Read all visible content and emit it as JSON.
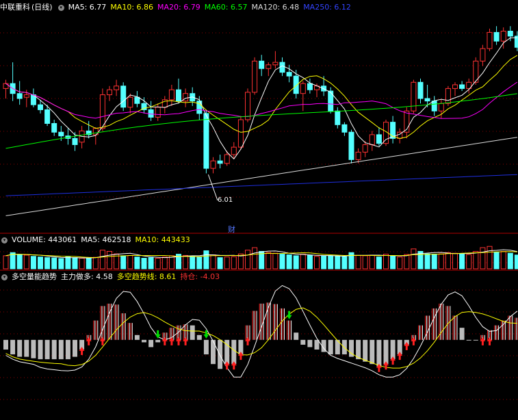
{
  "stock": {
    "name": "中联重科",
    "period": "(日线)"
  },
  "colors": {
    "up": "#ff3232",
    "down": "#54ffff",
    "ma5": "#ffffff",
    "ma10": "#ffff00",
    "ma20": "#ff00ff",
    "ma60": "#00ff00",
    "ma120": "#ffffff",
    "ma250": "#0000ff",
    "grid": "#8b0000",
    "gray": "#bbbbbb",
    "green_arrow": "#00dd00"
  },
  "price_header": {
    "ma5": "MA5: 6.77",
    "ma10": "MA10: 6.86",
    "ma20": "MA20: 6.79",
    "ma60": "MA60: 6.57",
    "ma120": "MA120: 6.48",
    "ma250": "MA250: 6.12"
  },
  "volume_header": {
    "volume": "VOLUME: 443061",
    "ma5": "MA5: 462518",
    "ma10": "MA10: 443433"
  },
  "indicator_header": {
    "name": "多空量能趋势",
    "main": "主力做多: 4.58",
    "trend": "多空趋势线: 8.61",
    "hold": "持仓: -4.03"
  },
  "annotations": {
    "low_label": "6.01",
    "fin_marker": "财"
  },
  "chart_data": [
    {
      "type": "candlestick",
      "title": "中联重科 (日线)",
      "y_range": [
        5.6,
        7.3
      ],
      "candles": [
        [
          6.7,
          6.77,
          6.62,
          6.74
        ],
        [
          6.74,
          6.91,
          6.6,
          6.66
        ],
        [
          6.66,
          6.76,
          6.57,
          6.62
        ],
        [
          6.63,
          6.69,
          6.55,
          6.65
        ],
        [
          6.65,
          6.7,
          6.55,
          6.57
        ],
        [
          6.57,
          6.61,
          6.5,
          6.53
        ],
        [
          6.53,
          6.57,
          6.4,
          6.42
        ],
        [
          6.42,
          6.45,
          6.32,
          6.35
        ],
        [
          6.35,
          6.4,
          6.28,
          6.32
        ],
        [
          6.32,
          6.38,
          6.25,
          6.3
        ],
        [
          6.3,
          6.35,
          6.2,
          6.25
        ],
        [
          6.27,
          6.4,
          6.22,
          6.36
        ],
        [
          6.36,
          6.44,
          6.3,
          6.33
        ],
        [
          6.33,
          6.39,
          6.25,
          6.38
        ],
        [
          6.38,
          6.7,
          6.36,
          6.65
        ],
        [
          6.65,
          6.72,
          6.6,
          6.69
        ],
        [
          6.69,
          6.77,
          6.64,
          6.72
        ],
        [
          6.72,
          6.75,
          6.52,
          6.55
        ],
        [
          6.55,
          6.66,
          6.5,
          6.63
        ],
        [
          6.63,
          6.68,
          6.55,
          6.58
        ],
        [
          6.58,
          6.63,
          6.5,
          6.53
        ],
        [
          6.53,
          6.6,
          6.44,
          6.47
        ],
        [
          6.47,
          6.58,
          6.44,
          6.55
        ],
        [
          6.55,
          6.64,
          6.5,
          6.61
        ],
        [
          6.61,
          6.73,
          6.56,
          6.69
        ],
        [
          6.69,
          6.78,
          6.58,
          6.6
        ],
        [
          6.6,
          6.7,
          6.55,
          6.66
        ],
        [
          6.66,
          6.71,
          6.56,
          6.6
        ],
        [
          6.6,
          6.64,
          6.45,
          6.5
        ],
        [
          6.5,
          6.53,
          6.02,
          6.06
        ],
        [
          6.06,
          6.15,
          6.02,
          6.12
        ],
        [
          6.12,
          6.17,
          6.06,
          6.1
        ],
        [
          6.1,
          6.2,
          6.08,
          6.17
        ],
        [
          6.17,
          6.27,
          6.14,
          6.23
        ],
        [
          6.23,
          6.48,
          6.21,
          6.45
        ],
        [
          6.45,
          6.7,
          6.43,
          6.67
        ],
        [
          6.67,
          6.95,
          6.65,
          6.92
        ],
        [
          6.92,
          6.97,
          6.8,
          6.86
        ],
        [
          6.86,
          6.91,
          6.8,
          6.89
        ],
        [
          6.89,
          7.0,
          6.86,
          6.91
        ],
        [
          6.91,
          6.95,
          6.8,
          6.83
        ],
        [
          6.83,
          6.89,
          6.75,
          6.8
        ],
        [
          6.8,
          6.85,
          6.62,
          6.66
        ],
        [
          6.66,
          6.76,
          6.52,
          6.74
        ],
        [
          6.74,
          6.78,
          6.66,
          6.69
        ],
        [
          6.69,
          6.74,
          6.63,
          6.72
        ],
        [
          6.72,
          6.8,
          6.64,
          6.68
        ],
        [
          6.68,
          6.71,
          6.5,
          6.52
        ],
        [
          6.52,
          6.55,
          6.38,
          6.41
        ],
        [
          6.41,
          6.43,
          6.32,
          6.35
        ],
        [
          6.35,
          6.37,
          6.1,
          6.13
        ],
        [
          6.13,
          6.22,
          6.1,
          6.19
        ],
        [
          6.19,
          6.28,
          6.15,
          6.25
        ],
        [
          6.25,
          6.36,
          6.2,
          6.33
        ],
        [
          6.33,
          6.39,
          6.24,
          6.26
        ],
        [
          6.26,
          6.45,
          6.24,
          6.43
        ],
        [
          6.43,
          6.48,
          6.26,
          6.3
        ],
        [
          6.3,
          6.38,
          6.26,
          6.35
        ],
        [
          6.35,
          6.55,
          6.3,
          6.52
        ],
        [
          6.52,
          6.77,
          6.5,
          6.75
        ],
        [
          6.75,
          6.78,
          6.58,
          6.62
        ],
        [
          6.62,
          6.73,
          6.55,
          6.6
        ],
        [
          6.6,
          6.64,
          6.48,
          6.52
        ],
        [
          6.52,
          6.61,
          6.46,
          6.58
        ],
        [
          6.58,
          6.72,
          6.56,
          6.7
        ],
        [
          6.7,
          6.75,
          6.64,
          6.73
        ],
        [
          6.73,
          6.76,
          6.68,
          6.7
        ],
        [
          6.7,
          6.78,
          6.66,
          6.75
        ],
        [
          6.75,
          6.95,
          6.73,
          6.92
        ],
        [
          6.92,
          7.05,
          6.88,
          7.02
        ],
        [
          7.02,
          7.18,
          7.0,
          7.15
        ],
        [
          7.15,
          7.2,
          7.05,
          7.08
        ],
        [
          7.08,
          7.19,
          7.02,
          7.16
        ],
        [
          7.16,
          7.2,
          7.08,
          7.12
        ],
        [
          7.12,
          7.16,
          7.0,
          7.03
        ]
      ],
      "low_marker": {
        "value": 6.01,
        "label": "6.01"
      }
    },
    {
      "type": "bar",
      "title": "VOLUME",
      "y_range": [
        0,
        1000000
      ],
      "series": [
        {
          "name": "VOLUME",
          "values": [
            420000,
            520000,
            460000,
            440000,
            400000,
            380000,
            360000,
            350000,
            330000,
            380000,
            360000,
            340000,
            330000,
            370000,
            600000,
            560000,
            480000,
            420000,
            430000,
            380000,
            340000,
            360000,
            340000,
            380000,
            420000,
            470000,
            430000,
            400000,
            380000,
            580000,
            450000,
            360000,
            380000,
            390000,
            480000,
            600000,
            680000,
            560000,
            520000,
            500000,
            470000,
            450000,
            420000,
            470000,
            430000,
            400000,
            410000,
            420000,
            410000,
            390000,
            520000,
            430000,
            420000,
            440000,
            380000,
            470000,
            410000,
            380000,
            460000,
            640000,
            560000,
            480000,
            470000,
            480000,
            520000,
            500000,
            490000,
            460000,
            560000,
            680000,
            720000,
            540000,
            560000,
            500000,
            443061
          ]
        }
      ]
    },
    {
      "type": "bar",
      "title": "多空量能趋势",
      "y_range": [
        -16,
        12
      ],
      "series": [
        {
          "name": "主力做多",
          "values": [
            -2,
            -3,
            -3.5,
            -3.5,
            -3.8,
            -4,
            -4,
            -4,
            -4,
            -4,
            -3.5,
            -2,
            1,
            4,
            7,
            7.5,
            7.3,
            5.5,
            3.5,
            1,
            -0.5,
            -1.5,
            -0.5,
            1.5,
            2.5,
            3,
            3.2,
            3,
            1,
            -3,
            -5,
            -6,
            -5,
            -5,
            -3,
            3,
            6,
            7.5,
            7.7,
            7.4,
            6.5,
            4,
            1.5,
            -1,
            -1.5,
            -2,
            -2.5,
            -3,
            -3,
            -3,
            -3.5,
            -4,
            -4.5,
            -5,
            -5.5,
            -5,
            -4,
            -3,
            -1,
            1,
            3,
            5,
            6.5,
            7.5,
            7,
            5,
            2.5,
            0,
            0,
            1,
            2,
            3,
            4,
            5,
            4.58
          ]
        }
      ]
    }
  ]
}
